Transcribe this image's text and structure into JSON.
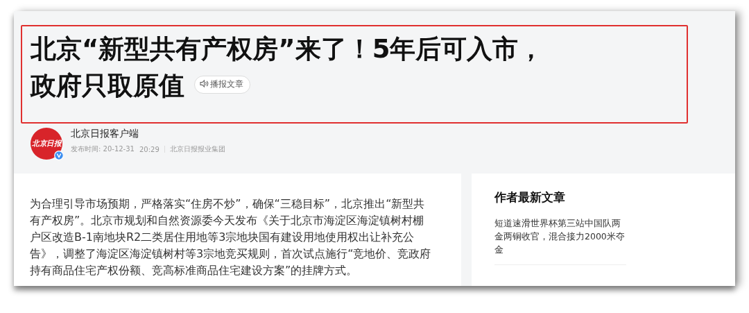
{
  "article": {
    "title": "北京“新型共有产权房”来了！5年后可入市，政府只取原值",
    "listen_button": "播报文章"
  },
  "author": {
    "logo_text": "北京日报",
    "name": "北京日报客户端",
    "verified": true,
    "published_label": "发布时间: 20-12-31",
    "time": "20:29",
    "source": "北京日报报业集团"
  },
  "body": {
    "paragraph": "为合理引导市场预期，严格落实“住房不炒”，确保“三稳目标”，北京推出“新型共有产权房”。北京市规划和自然资源委今天发布《关于北京市海淀区海淀镇树村棚户区改造B-1南地块R2二类居住用地等3宗地块国有建设用地使用权出让补充公告》，调整了海淀区海淀镇树村等3宗地竞买规则，首次试点施行“竞地价、竞政府持有商品住宅产权份额、竞高标准商品住宅建设方案”的挂牌方式。"
  },
  "sidebar": {
    "heading": "作者最新文章",
    "articles": [
      "短道速滑世界杯第三站中国队两金两铜收官，混合接力2000米夺金"
    ]
  }
}
